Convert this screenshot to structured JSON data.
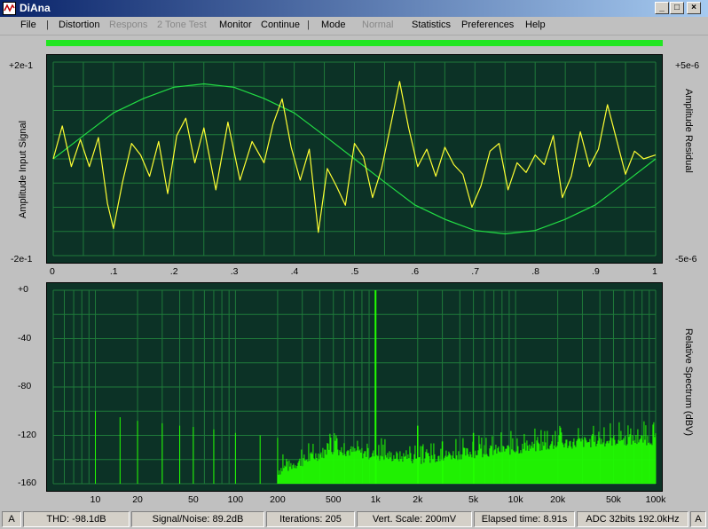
{
  "window": {
    "title": "DiAna"
  },
  "menu": {
    "items": [
      {
        "label": "File",
        "state": "enabled"
      },
      {
        "label": "|",
        "state": "separator"
      },
      {
        "label": "Distortion",
        "state": "enabled"
      },
      {
        "label": "Respons",
        "state": "disabled"
      },
      {
        "label": "2 Tone Test",
        "state": "disabled"
      },
      {
        "label": "Monitor",
        "state": "enabled"
      },
      {
        "label": "Continue",
        "state": "enabled"
      },
      {
        "label": "|",
        "state": "separator"
      },
      {
        "label": "Mode",
        "state": "enabled"
      },
      {
        "label": "Normal",
        "state": "disabled"
      },
      {
        "label": "Statistics",
        "state": "enabled"
      },
      {
        "label": "Preferences",
        "state": "enabled"
      },
      {
        "label": "Help",
        "state": "enabled"
      }
    ]
  },
  "colors": {
    "progress": "#22e622",
    "panel_bg": "#0c3226",
    "grid": "#1f7a3a",
    "input_trace": "#22dd44",
    "residual_trace": "#ffff33",
    "spectrum": "#22ff00"
  },
  "progress": {
    "fraction": 1.0
  },
  "chart_data": [
    {
      "type": "line",
      "title": "",
      "ylabel": "Amplitude Input Signal",
      "y2label": "Amplitude Residual",
      "x_ticks": [
        "0",
        ".1",
        ".2",
        ".3",
        ".4",
        ".5",
        ".6",
        ".7",
        ".8",
        ".9",
        "1"
      ],
      "xlim": [
        0,
        1
      ],
      "y_top_label": "+2e-1",
      "y_bottom_label": "-2e-1",
      "y2_top_label": "+5e-6",
      "y2_bottom_label": "-5e-6",
      "ylim": [
        -0.2,
        0.2
      ],
      "y2lim": [
        -5e-06,
        5e-06
      ],
      "grid": true,
      "series": [
        {
          "x": [
            0,
            0.05,
            0.1,
            0.15,
            0.2,
            0.25,
            0.3,
            0.35,
            0.4,
            0.45,
            0.5,
            0.55,
            0.6,
            0.65,
            0.7,
            0.75,
            0.8,
            0.85,
            0.9,
            0.95,
            1.0
          ],
          "y": [
            0,
            0.048,
            0.095,
            0.125,
            0.148,
            0.155,
            0.148,
            0.125,
            0.095,
            0.048,
            0,
            -0.048,
            -0.095,
            -0.125,
            -0.148,
            -0.155,
            -0.148,
            -0.125,
            -0.095,
            -0.048,
            0
          ]
        },
        {
          "x": [
            0,
            0.015,
            0.03,
            0.045,
            0.06,
            0.075,
            0.09,
            0.1,
            0.115,
            0.13,
            0.145,
            0.16,
            0.175,
            0.19,
            0.205,
            0.22,
            0.235,
            0.25,
            0.27,
            0.29,
            0.31,
            0.33,
            0.35,
            0.365,
            0.38,
            0.395,
            0.41,
            0.425,
            0.44,
            0.455,
            0.47,
            0.485,
            0.5,
            0.515,
            0.53,
            0.545,
            0.56,
            0.575,
            0.59,
            0.605,
            0.62,
            0.635,
            0.65,
            0.665,
            0.68,
            0.695,
            0.71,
            0.725,
            0.74,
            0.755,
            0.77,
            0.785,
            0.8,
            0.815,
            0.83,
            0.845,
            0.86,
            0.875,
            0.89,
            0.905,
            0.92,
            0.935,
            0.95,
            0.965,
            0.98,
            1.0
          ],
          "y": [
            0,
            1.7,
            -0.4,
            1.0,
            -0.4,
            1.1,
            -2.3,
            -3.6,
            -1.2,
            0.8,
            0.2,
            -0.9,
            0.9,
            -1.8,
            1.2,
            2.1,
            -0.2,
            1.6,
            -1.6,
            1.9,
            -1.1,
            0.9,
            -0.2,
            1.8,
            3.1,
            0.6,
            -1.1,
            0.5,
            -3.8,
            -0.5,
            -1.4,
            -2.4,
            0.8,
            0.1,
            -2.0,
            -0.5,
            1.7,
            4.0,
            1.6,
            -0.4,
            0.5,
            -0.9,
            0.6,
            -0.3,
            -0.8,
            -2.5,
            -1.4,
            0.4,
            0.8,
            -1.6,
            -0.2,
            -0.7,
            0.2,
            -0.3,
            1.2,
            -2.0,
            -0.9,
            1.4,
            -0.4,
            0.5,
            2.8,
            1.0,
            -0.8,
            0.4,
            0.0,
            0.2
          ]
        }
      ]
    },
    {
      "type": "bar",
      "title": "",
      "ylabel": "Relative Spectrum (dBV)",
      "y_ticks": [
        "+0",
        "-40",
        "-80",
        "-120",
        "-160"
      ],
      "ylim": [
        -160,
        0
      ],
      "x_scale": "log",
      "xlim": [
        5,
        100000
      ],
      "x_ticks": [
        {
          "value": 10,
          "label": "10"
        },
        {
          "value": 20,
          "label": "20"
        },
        {
          "value": 50,
          "label": "50"
        },
        {
          "value": 100,
          "label": "100"
        },
        {
          "value": 200,
          "label": "200"
        },
        {
          "value": 500,
          "label": "500"
        },
        {
          "value": 1000,
          "label": "1k"
        },
        {
          "value": 2000,
          "label": "2k"
        },
        {
          "value": 5000,
          "label": "5k"
        },
        {
          "value": 10000,
          "label": "10k"
        },
        {
          "value": 20000,
          "label": "20k"
        },
        {
          "value": 50000,
          "label": "50k"
        },
        {
          "value": 100000,
          "label": "100k"
        }
      ],
      "grid": true,
      "fundamental": {
        "frequency": 1000,
        "level": 0
      },
      "harmonics": [
        {
          "frequency": 2000,
          "level": -112
        },
        {
          "frequency": 3000,
          "level": -125
        },
        {
          "frequency": 5000,
          "level": -118
        }
      ],
      "spurs": [
        {
          "frequency": 10,
          "level": -100
        },
        {
          "frequency": 15,
          "level": -105
        },
        {
          "frequency": 20,
          "level": -108
        },
        {
          "frequency": 30,
          "level": -110
        },
        {
          "frequency": 40,
          "level": -112
        },
        {
          "frequency": 50,
          "level": -113
        },
        {
          "frequency": 70,
          "level": -115
        },
        {
          "frequency": 100,
          "level": -118
        },
        {
          "frequency": 150,
          "level": -120
        },
        {
          "frequency": 200,
          "level": -122
        }
      ],
      "noise_floor": [
        {
          "frequency": 200,
          "level": -150
        },
        {
          "frequency": 500,
          "level": -132
        },
        {
          "frequency": 1000,
          "level": -137
        },
        {
          "frequency": 2000,
          "level": -140
        },
        {
          "frequency": 5000,
          "level": -135
        },
        {
          "frequency": 10000,
          "level": -132
        },
        {
          "frequency": 20000,
          "level": -128
        },
        {
          "frequency": 50000,
          "level": -125
        },
        {
          "frequency": 100000,
          "level": -124
        }
      ]
    }
  ],
  "status": {
    "left_indicator": "A",
    "thd": "THD:  -98.1dB",
    "snr": "Signal/Noise:   89.2dB",
    "iterations": "Iterations: 205",
    "vscale": "Vert. Scale: 200mV",
    "elapsed": "Elapsed time: 8.91s",
    "adc": "ADC 32bits 192.0kHz",
    "right_indicator": "A"
  }
}
